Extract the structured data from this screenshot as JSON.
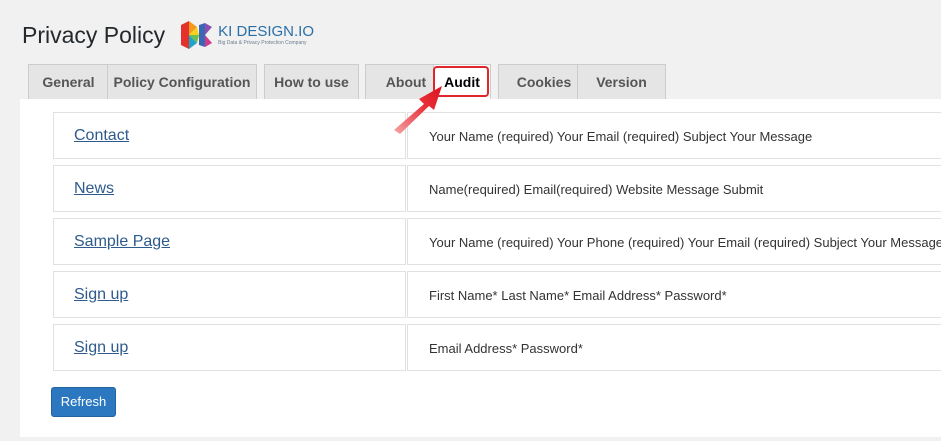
{
  "header": {
    "title": "Privacy Policy",
    "logo_name": "KI DESIGN.IO",
    "logo_tagline": "Big Data & Privacy Protection Company"
  },
  "tabs": [
    {
      "label": "General"
    },
    {
      "label": "Policy Configuration"
    },
    {
      "label": "How to use"
    },
    {
      "label": "About"
    },
    {
      "label": "Audit",
      "active": true
    },
    {
      "label": "Cookies"
    },
    {
      "label": "Version"
    }
  ],
  "audit": {
    "rows": [
      {
        "page": "Contact",
        "fields": "Your Name (required) Your Email (required) Subject Your Message"
      },
      {
        "page": "News",
        "fields": "Name(required) Email(required) Website Message Submit"
      },
      {
        "page": "Sample Page",
        "fields": "Your Name (required) Your Phone (required) Your Email (required) Subject Your Message"
      },
      {
        "page": "Sign up",
        "fields": "First Name* Last Name* Email Address* Password*"
      },
      {
        "page": "Sign up",
        "fields": "Email Address* Password*"
      }
    ],
    "refresh_label": "Refresh"
  },
  "colors": {
    "accent": "#2b78c0",
    "highlight": "#e0252b",
    "link": "#2e5b8c"
  }
}
